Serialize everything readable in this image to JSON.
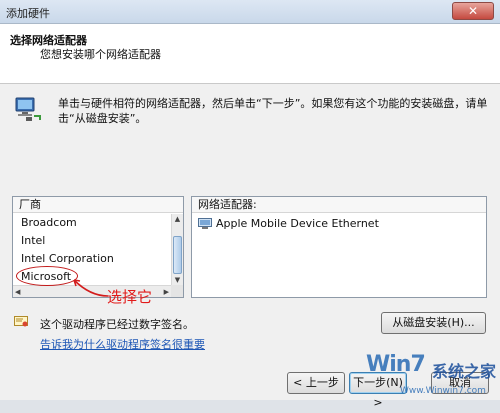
{
  "window": {
    "title": "添加硬件",
    "close_label": "✕"
  },
  "header": {
    "title": "选择网络适配器",
    "subtitle": "您想安装哪个网络适配器"
  },
  "instruction": "单击与硬件相符的网络适配器，然后单击“下一步”。如果您有这个功能的安装磁盘，请单击“从磁盘安装”。",
  "manufacturer_list": {
    "header": "厂商",
    "items": [
      "Broadcom",
      "Intel",
      "Intel Corporation",
      "Microsoft"
    ]
  },
  "adapter_list": {
    "header": "网络适配器:",
    "items": [
      "Apple Mobile Device Ethernet"
    ]
  },
  "annotation": {
    "label": "选择它",
    "color": "#e21a1a"
  },
  "signature": {
    "text": "这个驱动程序已经过数字签名。",
    "link": "告诉我为什么驱动程序签名很重要"
  },
  "buttons": {
    "have_disk": "从磁盘安装(H)...",
    "back": "< 上一步",
    "next": "下一步(N) >",
    "cancel": "取消"
  },
  "watermark": {
    "big": "Win7",
    "cn": "系统之家",
    "url": "Www.Winwin7.com"
  },
  "icons": {
    "network": "network-computer-icon",
    "adapter": "network-adapter-icon",
    "certificate": "certificate-icon"
  }
}
